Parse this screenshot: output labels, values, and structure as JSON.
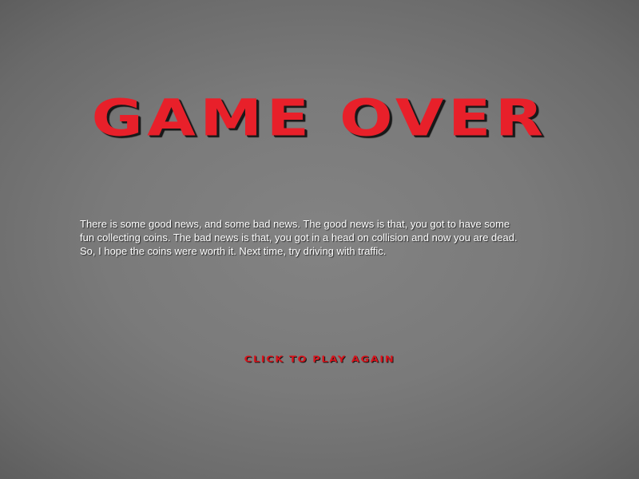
{
  "game_over": {
    "title": "GAME OVER",
    "message": "There is some good news, and some bad news.   The good news is that, you got to have some\nfun collecting coins.  The bad news is that, you got in a head on collision and now you are dead.\nSo, I hope the coins were worth it.  Next time, try driving with traffic.",
    "play_again_label": "CLICK TO PLAY AGAIN"
  },
  "colors": {
    "title": "#e8202a",
    "button": "#d8141c",
    "message": "#ffffff",
    "background": "#7a7a7a"
  }
}
